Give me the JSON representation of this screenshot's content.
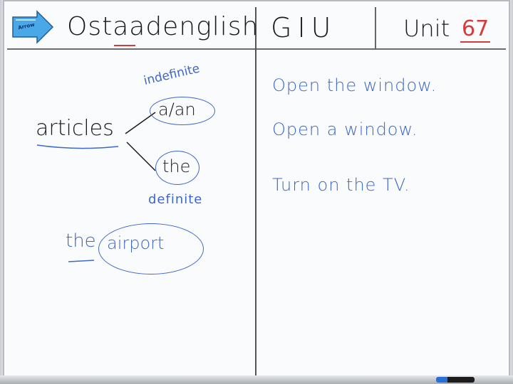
{
  "header": {
    "sticker_label": "Arrow",
    "brand": "Ostaadenglish",
    "brand_accent": "aa",
    "section": "GIU",
    "unit_label": "Unit",
    "unit_number": "67"
  },
  "left_panel": {
    "topic": "articles",
    "indefinite_label": "indefinite",
    "indefinite_form": "a/an",
    "definite_form": "the",
    "definite_label": "definite",
    "example_article": "the",
    "example_noun": "airport"
  },
  "right_panel": {
    "sentences": [
      "Open the window.",
      "Open a window.",
      "Turn on the TV."
    ]
  },
  "colors": {
    "ink_black": "#1b1b1b",
    "ink_blue": "#3d67c9",
    "ink_red": "#d63a3a",
    "sticker_blue": "#4aa8e8"
  }
}
